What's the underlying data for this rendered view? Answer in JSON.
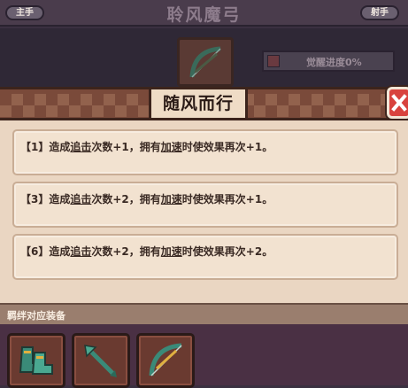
{
  "background": {
    "left_tag": "主手",
    "title": "聆风魔弓",
    "right_tag": "射手",
    "awakening_progress": "觉醒进度0%"
  },
  "popup": {
    "title": "随风而行",
    "effects": [
      {
        "prefix": "【1】造成",
        "kw1": "追击",
        "mid": "次数+1，拥有",
        "kw2": "加速",
        "suffix": "时使效果再次+1。"
      },
      {
        "prefix": "【3】造成",
        "kw1": "追击",
        "mid": "次数+2，拥有",
        "kw2": "加速",
        "suffix": "时使效果再次+1。"
      },
      {
        "prefix": "【6】造成",
        "kw1": "追击",
        "mid": "次数+2，拥有",
        "kw2": "加速",
        "suffix": "时使效果再次+2。"
      }
    ],
    "bond_label": "羁绊对应装备",
    "equipment_icons": [
      "boots-icon",
      "arrow-icon",
      "bow-icon"
    ]
  },
  "colors": {
    "panel": "#ead6c2",
    "banner": "#7a4a3a",
    "close": "#d8433e",
    "equip_bg": "#4a3044"
  }
}
